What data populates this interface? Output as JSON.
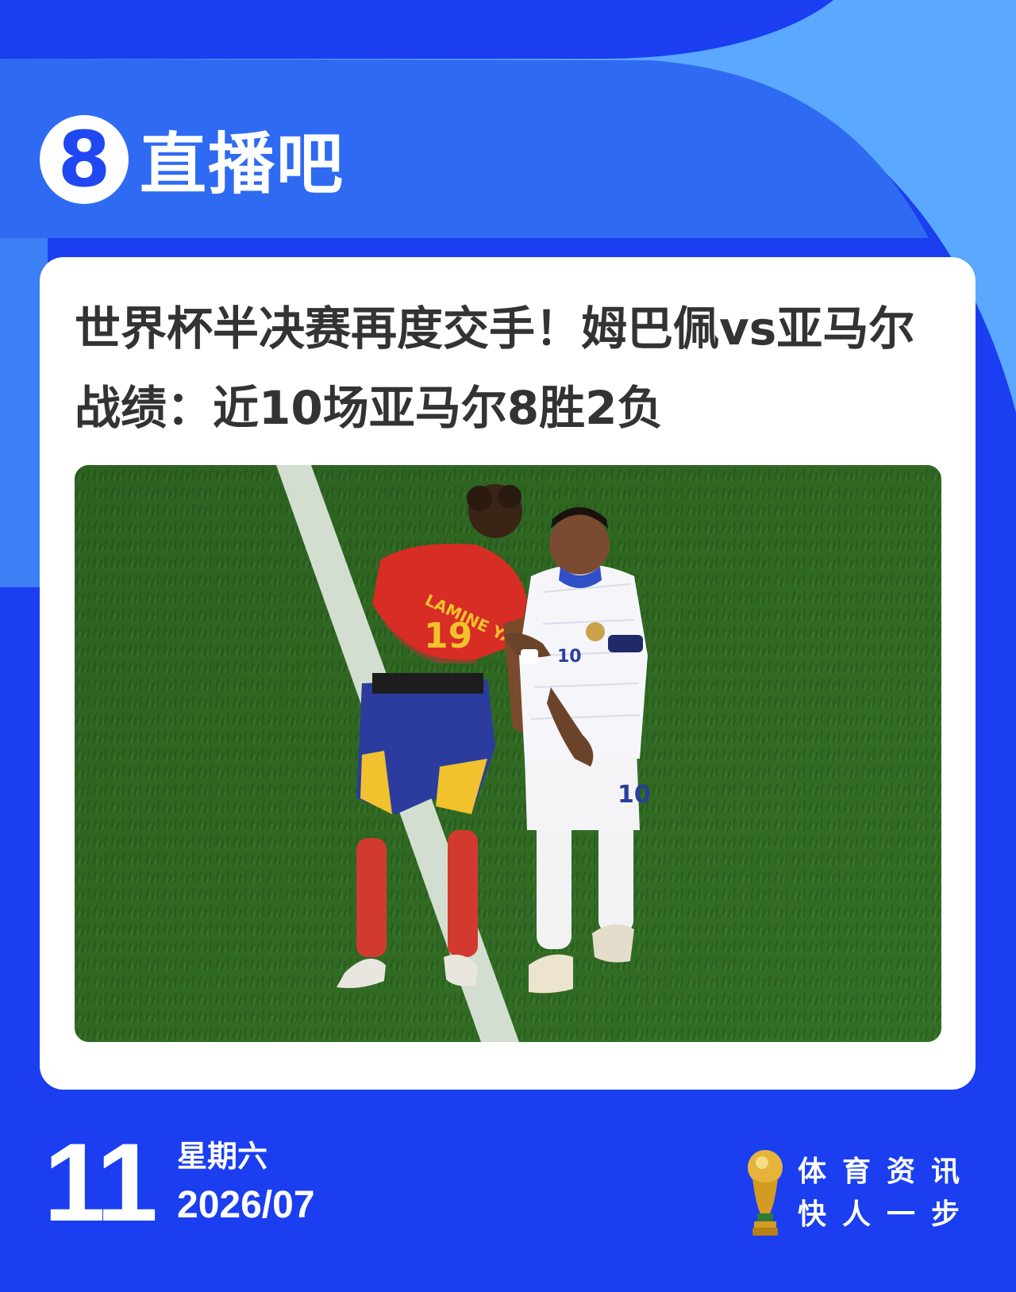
{
  "brand": {
    "logo_glyph": "8",
    "name": "直播吧",
    "primary_color": "#1a3ef0",
    "light_color": "#5aa8ff"
  },
  "article": {
    "headline": "世界杯半决赛再度交手！姆巴佩vs亚马尔战绩：近10场亚马尔8胜2负",
    "photo_subject": "football-players-spain-vs-france"
  },
  "footer": {
    "day": "11",
    "weekday": "星期六",
    "year_month": "2026/07",
    "slogan_line1": "体育资讯",
    "slogan_line2": "快人一步",
    "trophy_icon": "world-cup-trophy-icon"
  }
}
